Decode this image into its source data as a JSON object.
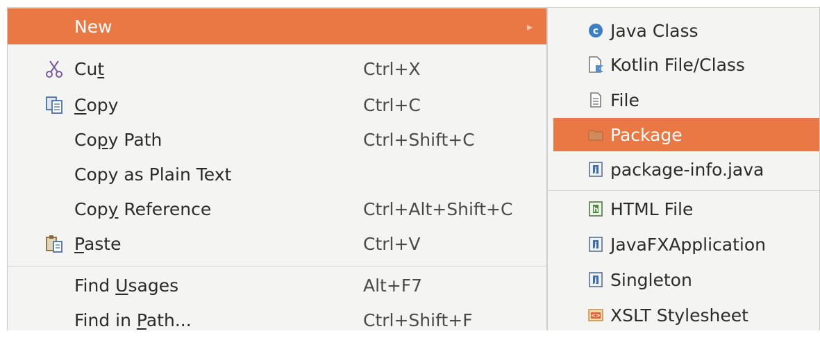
{
  "main_menu": {
    "new": {
      "label": "New",
      "arrow": "▸"
    },
    "cut": {
      "prefix": "Cu",
      "mnemonic": "t",
      "suffix": "",
      "shortcut": "Ctrl+X",
      "icon": "scissors-icon"
    },
    "copy": {
      "prefix": "",
      "mnemonic": "C",
      "suffix": "opy",
      "shortcut": "Ctrl+C",
      "icon": "copy-icon"
    },
    "copy_path": {
      "prefix": "Co",
      "mnemonic": "p",
      "suffix": "y Path",
      "shortcut": "Ctrl+Shift+C"
    },
    "copy_plain": {
      "label": "Copy as Plain Text"
    },
    "copy_reference": {
      "prefix": "Cop",
      "mnemonic": "y",
      "suffix": " Reference",
      "shortcut": "Ctrl+Alt+Shift+C"
    },
    "paste": {
      "prefix": "",
      "mnemonic": "P",
      "suffix": "aste",
      "shortcut": "Ctrl+V",
      "icon": "paste-icon"
    },
    "find_usages": {
      "prefix": "Find ",
      "mnemonic": "U",
      "suffix": "sages",
      "shortcut": "Alt+F7"
    },
    "find_in_path": {
      "prefix": "Find in ",
      "mnemonic": "P",
      "suffix": "ath...",
      "shortcut": "Ctrl+Shift+F"
    }
  },
  "submenu": {
    "items": [
      {
        "label": "Java Class",
        "icon": "java-class-icon"
      },
      {
        "label": "Kotlin File/Class",
        "icon": "kotlin-file-icon"
      },
      {
        "label": "File",
        "icon": "file-icon"
      },
      {
        "label": "Package",
        "icon": "package-icon"
      },
      {
        "label": "package-info.java",
        "icon": "java-file-icon"
      },
      {
        "label": "HTML File",
        "icon": "html-file-icon"
      },
      {
        "label": "JavaFXApplication",
        "icon": "java-file-icon"
      },
      {
        "label": "Singleton",
        "icon": "java-file-icon"
      },
      {
        "label": "XSLT Stylesheet",
        "icon": "xslt-icon"
      }
    ]
  },
  "colors": {
    "highlight": "#e97844",
    "background": "#f4f4f2"
  }
}
